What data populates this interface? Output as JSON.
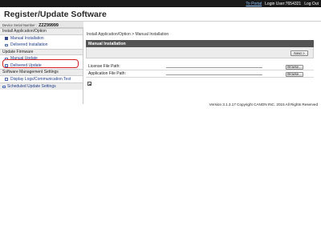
{
  "topbar": {
    "portal_link": "To Portal",
    "user_label": "Login User:7654321",
    "logout_link": "Log Out"
  },
  "header": {
    "title": "Register/Update Software"
  },
  "device": {
    "serial_label": "Device Serial Number :",
    "serial_value": "ZZZ99999"
  },
  "sidebar": {
    "sections": [
      {
        "label": "Install Application/Option",
        "items": [
          {
            "label": "Manual Installation"
          },
          {
            "label": "Delivered Installation"
          }
        ]
      },
      {
        "label": "Update Firmware",
        "items": [
          {
            "label": "Manual Update"
          },
          {
            "label": "Delivered Update"
          }
        ]
      },
      {
        "label": "Software Management Settings",
        "items": [
          {
            "label": "Display Logs/Communication Test"
          }
        ]
      }
    ],
    "scheduled": {
      "label": "Scheduled Update Settings"
    }
  },
  "main": {
    "breadcrumb": "Install Application/Option > Manual Installation",
    "panel_title": "Manual Installation",
    "next_button": "Next >",
    "fields": [
      {
        "label": "License File Path:",
        "button": "Browse..."
      },
      {
        "label": "Application File Path:",
        "button": "Browse..."
      }
    ]
  },
  "footer": {
    "text": "Version 3.1.3.17 Copyright CANON INC. 2015 All Rights Reserved"
  },
  "colors": {
    "topbar_bg": "#1a1a1a",
    "panel_header_bg": "#535353",
    "highlight": "#d42020",
    "link": "#1f3c88"
  }
}
